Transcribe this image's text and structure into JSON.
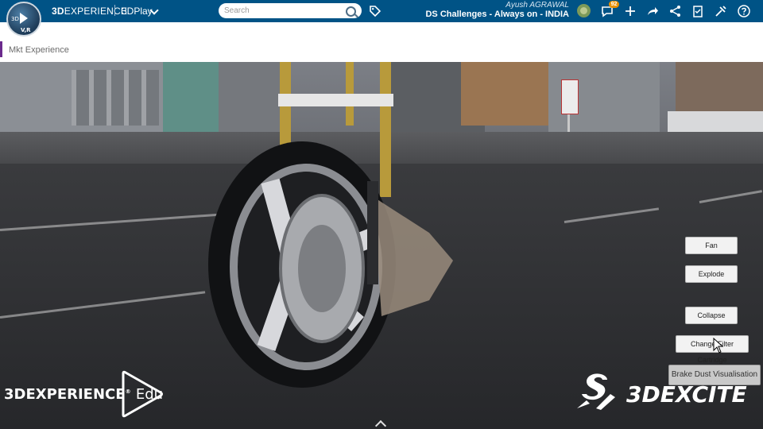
{
  "topbar": {
    "compass": {
      "label": "3D",
      "version": "V,R"
    },
    "brand_bold": "3D",
    "brand_rest": "EXPERIENCE",
    "app_name": "3DPlay",
    "search": {
      "placeholder": "Search",
      "value": ""
    },
    "user_name": "Ayush AGRAWAL",
    "collab_space": "DS Challenges - Always on - INDIA",
    "notifications_count": "92",
    "icons": [
      "compass-icon",
      "chevron-down-icon",
      "search-icon",
      "tag-icon",
      "avatar",
      "chat-icon",
      "plus-icon",
      "share-icon",
      "network-icon",
      "clipboard-icon",
      "tools-icon",
      "help-icon"
    ]
  },
  "subbar": {
    "title": "Mkt Experience",
    "accent_color": "#6b2a8d"
  },
  "viewport": {
    "buttons": {
      "fan": "Fan",
      "explode": "Explode",
      "collapse": "Collapse",
      "change_filter_cartridge": "Change Filter Cartridge",
      "brake_dust": "Brake Dust Visualisation"
    },
    "logo_left": {
      "main": "3DEXPERIENCE",
      "reg": "®",
      "suffix": "Edu"
    },
    "logo_right": {
      "text": "3DEXCITE"
    }
  },
  "colors": {
    "topbar": "#005386",
    "badge": "#e89000",
    "accent": "#6b2a8d"
  }
}
